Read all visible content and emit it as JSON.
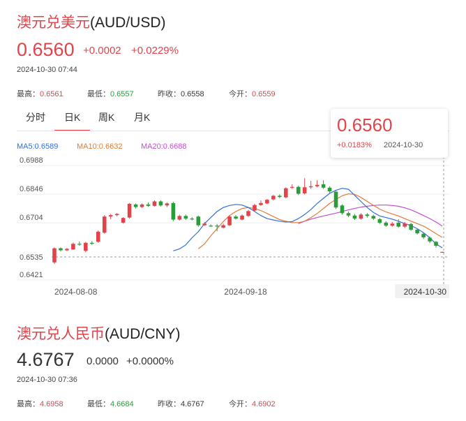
{
  "aud_usd": {
    "title_cn": "澳元兑美元",
    "title_code": "(AUD/USD)",
    "price": "0.6560",
    "change": "+0.0002",
    "change_pct": "+0.0229%",
    "timestamp": "2024-10-30 07:44",
    "stats": [
      {
        "label": "最高：",
        "value": "0.6561",
        "color": "#e0434a"
      },
      {
        "label": "最低：",
        "value": "0.6557",
        "color": "#2a9d3a"
      },
      {
        "label": "昨收：",
        "value": "0.6558",
        "color": "#333333"
      },
      {
        "label": "今开：",
        "value": "0.6559",
        "color": "#e0434a"
      }
    ]
  },
  "tabs": [
    {
      "label": "分时",
      "active": false
    },
    {
      "label": "日K",
      "active": true
    },
    {
      "label": "周K",
      "active": false
    },
    {
      "label": "月K",
      "active": false
    }
  ],
  "ma_legend": [
    {
      "text": "MA5:0.6589",
      "color": "#2f6fe0"
    },
    {
      "text": "MA10:0.6632",
      "color": "#e07b39"
    },
    {
      "text": "MA20:0.6688",
      "color": "#c04fd0"
    }
  ],
  "tooltip": {
    "price": "0.6560",
    "change_pct": "+0.0183%",
    "date": "2024-10-30"
  },
  "chart_data": {
    "type": "candlestick",
    "y_ticks": [
      "0.6988",
      "0.6846",
      "0.6704",
      "0.6535",
      "0.6421"
    ],
    "ylim": [
      0.6421,
      0.6988
    ],
    "x_ticks": [
      "2024-08-08",
      "2024-09-18",
      "2024-10-30"
    ],
    "current_price_line": 0.6535,
    "colors": {
      "up": "#e0434a",
      "down": "#2a9d3a"
    },
    "candles": [
      {
        "o": 0.6508,
        "c": 0.6578,
        "h": 0.6582,
        "l": 0.65
      },
      {
        "o": 0.6578,
        "c": 0.6568,
        "h": 0.6582,
        "l": 0.6562
      },
      {
        "o": 0.6568,
        "c": 0.6575,
        "h": 0.658,
        "l": 0.6564
      },
      {
        "o": 0.6572,
        "c": 0.66,
        "h": 0.6606,
        "l": 0.657
      },
      {
        "o": 0.66,
        "c": 0.6596,
        "h": 0.6612,
        "l": 0.659
      },
      {
        "o": 0.6565,
        "c": 0.6605,
        "h": 0.661,
        "l": 0.6558
      },
      {
        "o": 0.6605,
        "c": 0.66,
        "h": 0.6614,
        "l": 0.6595
      },
      {
        "o": 0.661,
        "c": 0.666,
        "h": 0.6666,
        "l": 0.6605
      },
      {
        "o": 0.6655,
        "c": 0.6735,
        "h": 0.6742,
        "l": 0.665
      },
      {
        "o": 0.6735,
        "c": 0.6742,
        "h": 0.6748,
        "l": 0.6722
      },
      {
        "o": 0.6742,
        "c": 0.6748,
        "h": 0.6752,
        "l": 0.6736
      },
      {
        "o": 0.6705,
        "c": 0.6728,
        "h": 0.6732,
        "l": 0.67
      },
      {
        "o": 0.673,
        "c": 0.6798,
        "h": 0.6802,
        "l": 0.6725
      },
      {
        "o": 0.6795,
        "c": 0.6782,
        "h": 0.68,
        "l": 0.6775
      },
      {
        "o": 0.6782,
        "c": 0.6795,
        "h": 0.68,
        "l": 0.6778
      },
      {
        "o": 0.6795,
        "c": 0.6788,
        "h": 0.6805,
        "l": 0.6783
      },
      {
        "o": 0.6788,
        "c": 0.681,
        "h": 0.6815,
        "l": 0.6785
      },
      {
        "o": 0.681,
        "c": 0.679,
        "h": 0.6816,
        "l": 0.6785
      },
      {
        "o": 0.679,
        "c": 0.68,
        "h": 0.6805,
        "l": 0.6782
      },
      {
        "o": 0.6802,
        "c": 0.672,
        "h": 0.6808,
        "l": 0.6712
      },
      {
        "o": 0.672,
        "c": 0.6738,
        "h": 0.6744,
        "l": 0.6715
      },
      {
        "o": 0.6738,
        "c": 0.6725,
        "h": 0.6745,
        "l": 0.6718
      },
      {
        "o": 0.6725,
        "c": 0.6722,
        "h": 0.6732,
        "l": 0.6716
      },
      {
        "o": 0.6735,
        "c": 0.6692,
        "h": 0.674,
        "l": 0.6684
      },
      {
        "o": 0.6692,
        "c": 0.67,
        "h": 0.6708,
        "l": 0.6688
      },
      {
        "o": 0.669,
        "c": 0.6688,
        "h": 0.6696,
        "l": 0.6684
      },
      {
        "o": 0.669,
        "c": 0.6686,
        "h": 0.6698,
        "l": 0.6662
      },
      {
        "o": 0.668,
        "c": 0.6692,
        "h": 0.67,
        "l": 0.6676
      },
      {
        "o": 0.6692,
        "c": 0.6735,
        "h": 0.6742,
        "l": 0.6688
      },
      {
        "o": 0.6735,
        "c": 0.6725,
        "h": 0.6742,
        "l": 0.672
      },
      {
        "o": 0.672,
        "c": 0.674,
        "h": 0.6746,
        "l": 0.6716
      },
      {
        "o": 0.6738,
        "c": 0.6762,
        "h": 0.6768,
        "l": 0.6734
      },
      {
        "o": 0.6765,
        "c": 0.6792,
        "h": 0.6798,
        "l": 0.676
      },
      {
        "o": 0.6792,
        "c": 0.6802,
        "h": 0.6815,
        "l": 0.6788
      },
      {
        "o": 0.68,
        "c": 0.6818,
        "h": 0.6822,
        "l": 0.6796
      },
      {
        "o": 0.682,
        "c": 0.6838,
        "h": 0.6842,
        "l": 0.6815
      },
      {
        "o": 0.6838,
        "c": 0.6832,
        "h": 0.6845,
        "l": 0.6826
      },
      {
        "o": 0.683,
        "c": 0.6875,
        "h": 0.688,
        "l": 0.6826
      },
      {
        "o": 0.6878,
        "c": 0.6882,
        "h": 0.6895,
        "l": 0.6872
      },
      {
        "o": 0.6882,
        "c": 0.6848,
        "h": 0.6888,
        "l": 0.6842
      },
      {
        "o": 0.685,
        "c": 0.688,
        "h": 0.6925,
        "l": 0.6845
      },
      {
        "o": 0.688,
        "c": 0.6885,
        "h": 0.6912,
        "l": 0.6872
      },
      {
        "o": 0.6885,
        "c": 0.6892,
        "h": 0.6915,
        "l": 0.688
      },
      {
        "o": 0.6895,
        "c": 0.6878,
        "h": 0.6915,
        "l": 0.6872
      },
      {
        "o": 0.6878,
        "c": 0.686,
        "h": 0.6885,
        "l": 0.6852
      },
      {
        "o": 0.6858,
        "c": 0.678,
        "h": 0.6862,
        "l": 0.6772
      },
      {
        "o": 0.679,
        "c": 0.6752,
        "h": 0.6796,
        "l": 0.6745
      },
      {
        "o": 0.6752,
        "c": 0.674,
        "h": 0.676,
        "l": 0.6732
      },
      {
        "o": 0.674,
        "c": 0.6725,
        "h": 0.6748,
        "l": 0.6718
      },
      {
        "o": 0.6725,
        "c": 0.6745,
        "h": 0.6752,
        "l": 0.672
      },
      {
        "o": 0.6745,
        "c": 0.6738,
        "h": 0.6752,
        "l": 0.673
      },
      {
        "o": 0.6738,
        "c": 0.6725,
        "h": 0.6744,
        "l": 0.6718
      },
      {
        "o": 0.6722,
        "c": 0.6704,
        "h": 0.6728,
        "l": 0.6698
      },
      {
        "o": 0.6705,
        "c": 0.669,
        "h": 0.6712,
        "l": 0.6684
      },
      {
        "o": 0.669,
        "c": 0.67,
        "h": 0.6708,
        "l": 0.6685
      },
      {
        "o": 0.6705,
        "c": 0.6685,
        "h": 0.6722,
        "l": 0.668
      },
      {
        "o": 0.6685,
        "c": 0.67,
        "h": 0.6708,
        "l": 0.6678
      },
      {
        "o": 0.6698,
        "c": 0.667,
        "h": 0.6704,
        "l": 0.6664
      },
      {
        "o": 0.667,
        "c": 0.6652,
        "h": 0.6676,
        "l": 0.6646
      },
      {
        "o": 0.665,
        "c": 0.6632,
        "h": 0.6656,
        "l": 0.6624
      },
      {
        "o": 0.663,
        "c": 0.6612,
        "h": 0.6636,
        "l": 0.6604
      },
      {
        "o": 0.661,
        "c": 0.659,
        "h": 0.6614,
        "l": 0.6582
      },
      {
        "o": 0.6559,
        "c": 0.656,
        "h": 0.6561,
        "l": 0.6557
      }
    ],
    "ma5": [
      0.6565,
      0.6575,
      0.6595,
      0.663,
      0.666,
      0.67,
      0.673,
      0.676,
      0.678,
      0.679,
      0.6795,
      0.6792,
      0.678,
      0.676,
      0.674,
      0.6725,
      0.6718,
      0.6712,
      0.6708,
      0.671,
      0.6725,
      0.6745,
      0.677,
      0.68,
      0.6825,
      0.685,
      0.6865,
      0.6875,
      0.687,
      0.684,
      0.681,
      0.678,
      0.6755,
      0.6738,
      0.673,
      0.6722,
      0.6712,
      0.67,
      0.669,
      0.6675,
      0.6655,
      0.663,
      0.66,
      0.658
    ],
    "ma10": [
      0.6575,
      0.66,
      0.664,
      0.6675,
      0.671,
      0.674,
      0.676,
      0.6775,
      0.678,
      0.6775,
      0.6765,
      0.675,
      0.6735,
      0.672,
      0.6712,
      0.6705,
      0.6705,
      0.6712,
      0.673,
      0.675,
      0.6775,
      0.68,
      0.682,
      0.6838,
      0.6848,
      0.6845,
      0.683,
      0.681,
      0.679,
      0.6772,
      0.6758,
      0.6748,
      0.6738,
      0.6725,
      0.6712,
      0.67,
      0.6688,
      0.667,
      0.665,
      0.6632
    ],
    "ma20": [
      0.67,
      0.6712,
      0.6722,
      0.673,
      0.6738,
      0.6745,
      0.6752,
      0.676,
      0.6768,
      0.6775,
      0.6782,
      0.6786,
      0.679,
      0.6792,
      0.6792,
      0.679,
      0.6786,
      0.6778,
      0.6768,
      0.6755,
      0.674,
      0.6725,
      0.6708,
      0.6688
    ]
  },
  "aud_cny": {
    "title_cn": "澳元兑人民币",
    "title_code": "(AUD/CNY)",
    "price": "4.6767",
    "change": "0.0000",
    "change_pct": "+0.0000%",
    "timestamp": "2024-10-30 07:36",
    "stats": [
      {
        "label": "最高：",
        "value": "4.6958",
        "color": "#e0434a"
      },
      {
        "label": "最低：",
        "value": "4.6684",
        "color": "#2a9d3a"
      },
      {
        "label": "昨收：",
        "value": "4.6767",
        "color": "#333333"
      },
      {
        "label": "今开：",
        "value": "4.6902",
        "color": "#e0434a"
      }
    ]
  }
}
